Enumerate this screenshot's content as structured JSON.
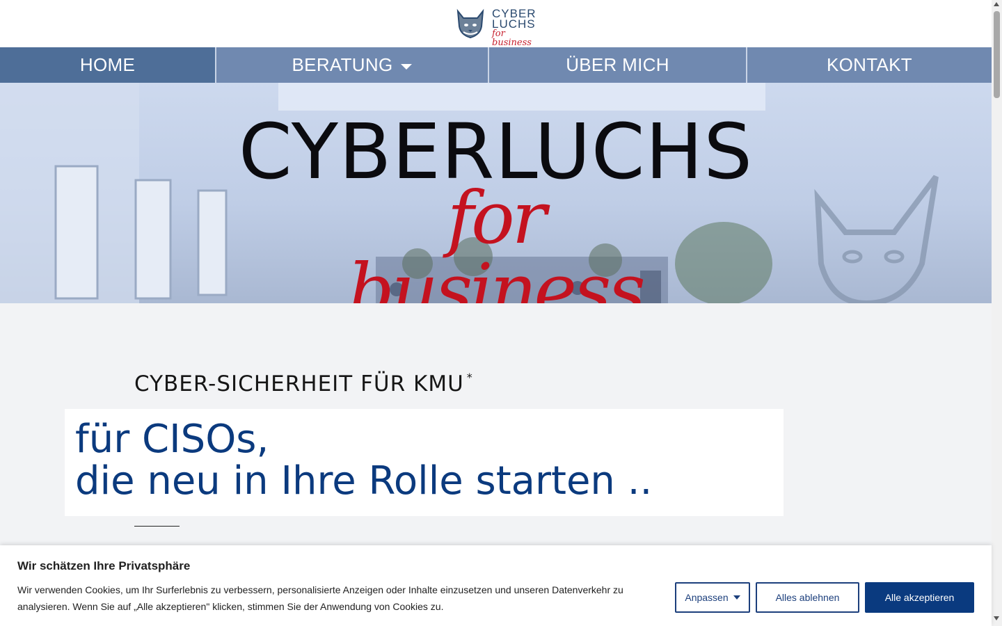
{
  "logo": {
    "line1": "CYBER",
    "line2": "LUCHS",
    "line3": "for business"
  },
  "nav": {
    "items": [
      {
        "label": "HOME",
        "active": true
      },
      {
        "label": "BERATUNG",
        "has_dropdown": true
      },
      {
        "label": "ÜBER MICH"
      },
      {
        "label": "KONTAKT"
      }
    ]
  },
  "hero": {
    "title": "CYBERLUCHS",
    "subtitle": "for business"
  },
  "main": {
    "kicker": "CYBER-SICHERHEIT FÜR KMU",
    "kicker_mark": "*",
    "headline_line1": "für CISOs,",
    "headline_line2": "die neu in Ihre Rolle starten .."
  },
  "cookie": {
    "title": "Wir schätzen Ihre Privatsphäre",
    "text": "Wir verwenden Cookies, um Ihr Surferlebnis zu verbessern, personalisierte Anzeigen oder Inhalte einzusetzen und unseren Datenverkehr zu analysieren. Wenn Sie auf „Alle akzeptieren\" klicken, stimmen Sie der Anwendung von Cookies zu.",
    "customize_label": "Anpassen",
    "reject_label": "Alles ablehnen",
    "accept_label": "Alle akzeptieren"
  },
  "colors": {
    "nav_bg": "#7089b0",
    "nav_active": "#4e6e98",
    "headline": "#0b3a7e",
    "accent_red": "#c4121f",
    "button_primary": "#0a3a7f"
  }
}
